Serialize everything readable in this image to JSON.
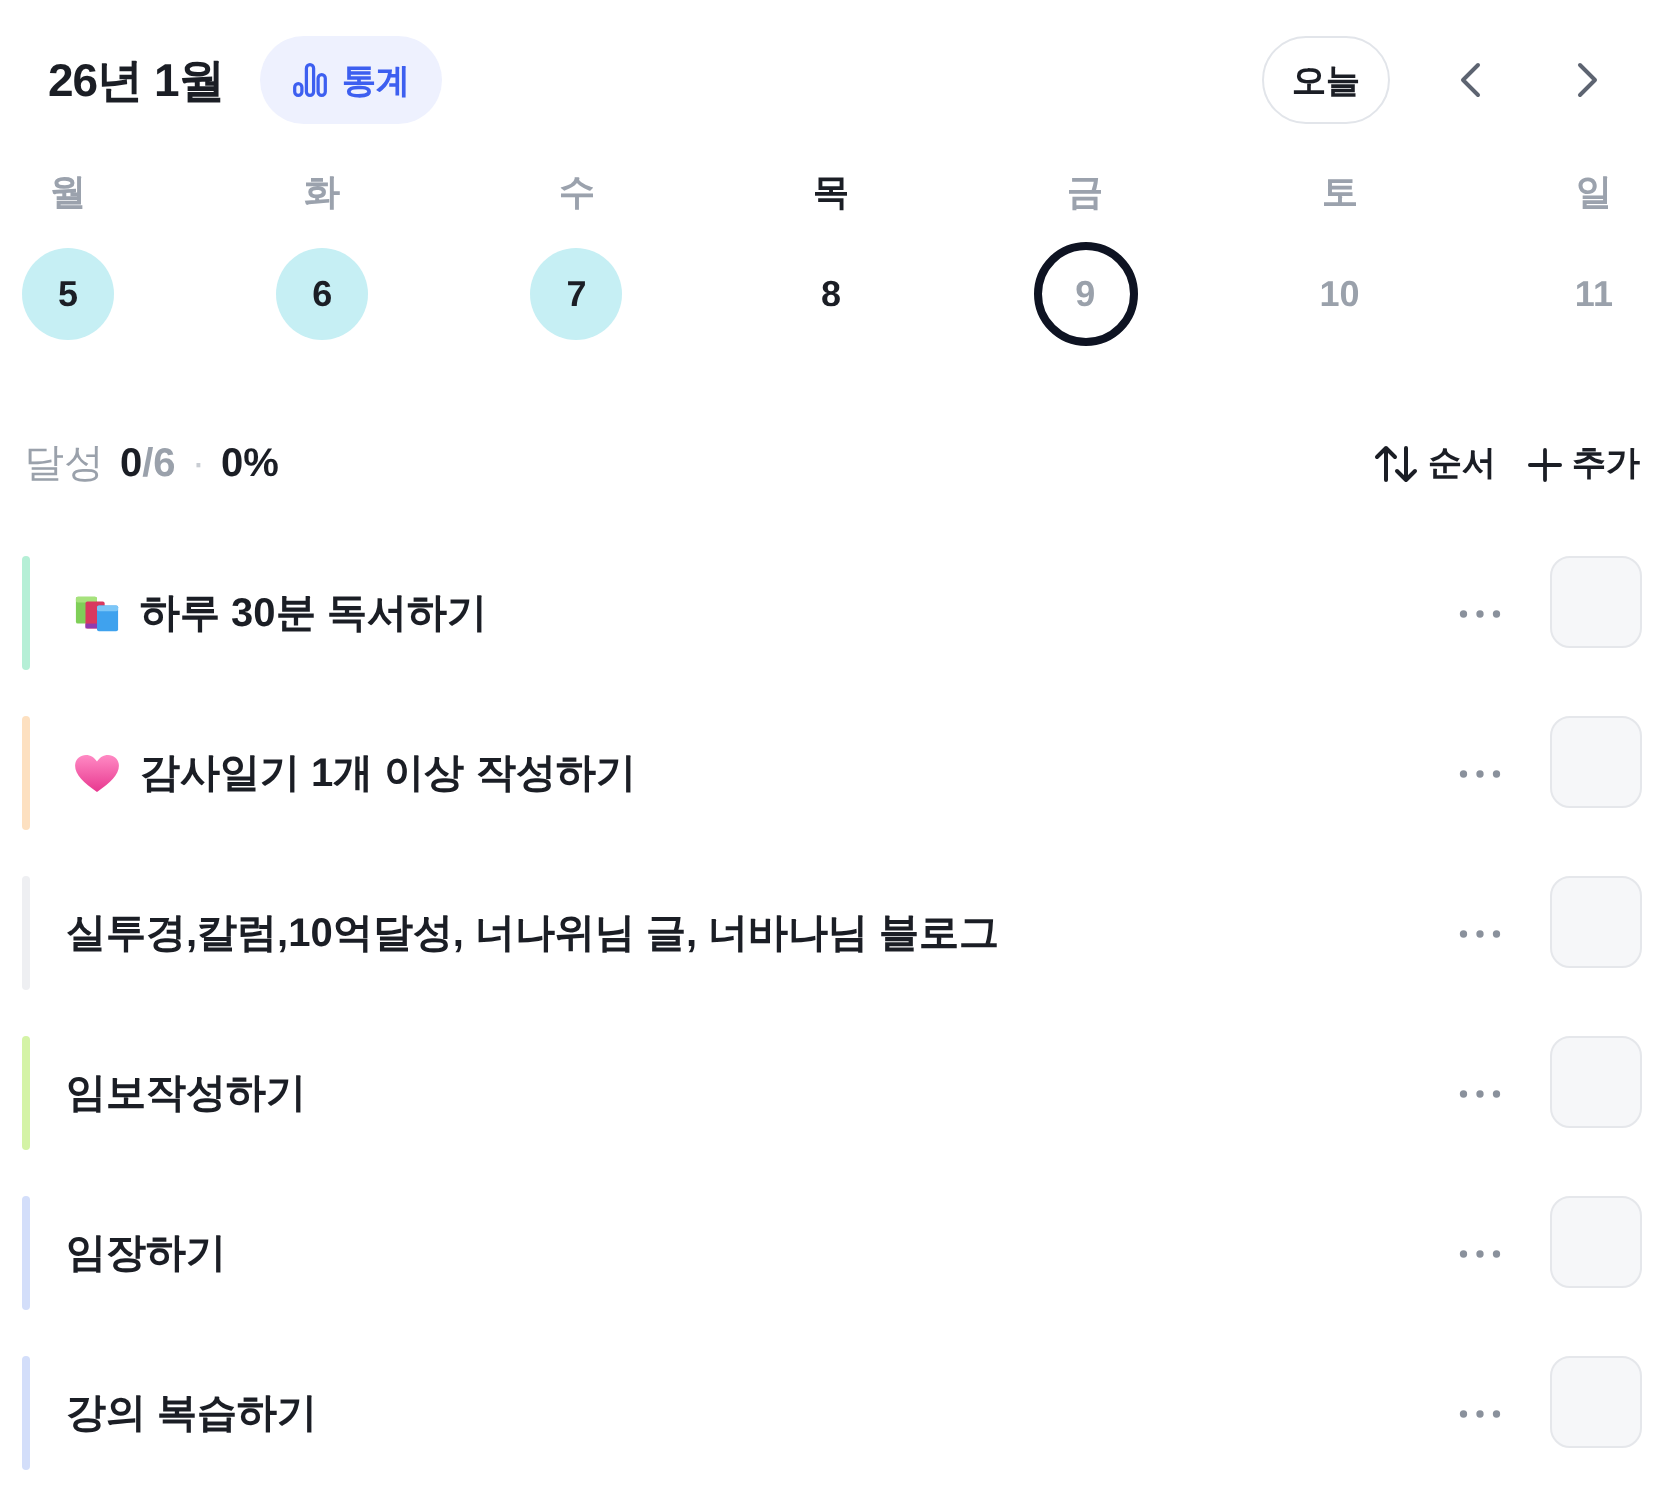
{
  "header": {
    "title": "26년 1월",
    "stats_button": "통계",
    "today_button": "오늘"
  },
  "week": [
    {
      "weekday": "월",
      "date": "5",
      "completed": true,
      "today": false,
      "selected": false,
      "future": false
    },
    {
      "weekday": "화",
      "date": "6",
      "completed": true,
      "today": false,
      "selected": false,
      "future": false
    },
    {
      "weekday": "수",
      "date": "7",
      "completed": true,
      "today": false,
      "selected": false,
      "future": false
    },
    {
      "weekday": "목",
      "date": "8",
      "completed": false,
      "today": true,
      "selected": false,
      "future": false
    },
    {
      "weekday": "금",
      "date": "9",
      "completed": false,
      "today": false,
      "selected": true,
      "future": true
    },
    {
      "weekday": "토",
      "date": "10",
      "completed": false,
      "today": false,
      "selected": false,
      "future": true
    },
    {
      "weekday": "일",
      "date": "11",
      "completed": false,
      "today": false,
      "selected": false,
      "future": true
    }
  ],
  "summary": {
    "label": "달성",
    "done": "0",
    "total": "/6",
    "separator": "·",
    "percent": "0%",
    "sort_button": "순서",
    "add_button": "추가"
  },
  "habits": [
    {
      "title": "하루 30분 독서하기",
      "kind": "books",
      "color": "#b5efd6",
      "checked": false
    },
    {
      "title": "감사일기 1개 이상 작성하기",
      "kind": "heart",
      "color": "#fde0c0",
      "checked": false
    },
    {
      "title": "실투경,칼럼,10억달성, 너나위님 글, 너바나님 블로그",
      "kind": "plain",
      "color": "#eeeff2",
      "checked": false
    },
    {
      "title": "임보작성하기",
      "kind": "plain",
      "color": "#d4f3a6",
      "checked": false
    },
    {
      "title": "임장하기",
      "kind": "plain",
      "color": "#d3defa",
      "checked": false
    },
    {
      "title": "강의 복습하기",
      "kind": "plain",
      "color": "#d3defa",
      "checked": false
    }
  ]
}
